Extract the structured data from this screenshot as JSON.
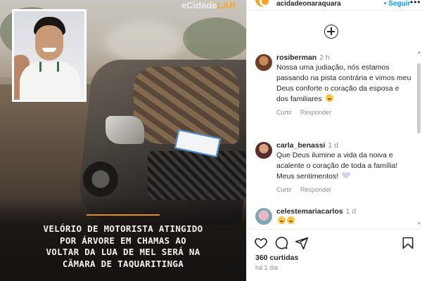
{
  "post": {
    "watermark_prefix": "eCidade",
    "watermark_accent": "LAR",
    "headline": "VELÓRIO DE MOTORISTA ATINGIDO\nPOR ÁRVORE EM CHAMAS AO\nVOLTAR DA LUA DE MEL SERÁ NA\nCÂMARA DE TAQUARITINGA",
    "accent_color": "#e8882b"
  },
  "header": {
    "username": "acidadeonaraquara",
    "follow_label": "• Seguir",
    "more_icon": "more-icon"
  },
  "comments": [
    {
      "username": "rosiberman",
      "time": "2 h",
      "text": "Nossa uma judiação, nós estamos passando na pista contrária e vimos meu Deus conforte o coração da esposa e dos familiares",
      "emoji": "sad-face-emoji",
      "reply_label": "Curtir",
      "respond_label": "Responder"
    },
    {
      "username": "carla_benassi",
      "time": "1 d",
      "text": "Que Deus ilumine a vida da noiva e acalente o coração de toda a família! Meus sentimentos!",
      "emoji": "heart-emoji",
      "reply_label": "Curtir",
      "respond_label": "Responder"
    },
    {
      "username": "celestemariacarlos",
      "time": "1 d",
      "text": "",
      "emoji": "sad-face-emoji"
    }
  ],
  "footer": {
    "likes": "360 curtidas",
    "posted": "há 1 dia"
  }
}
